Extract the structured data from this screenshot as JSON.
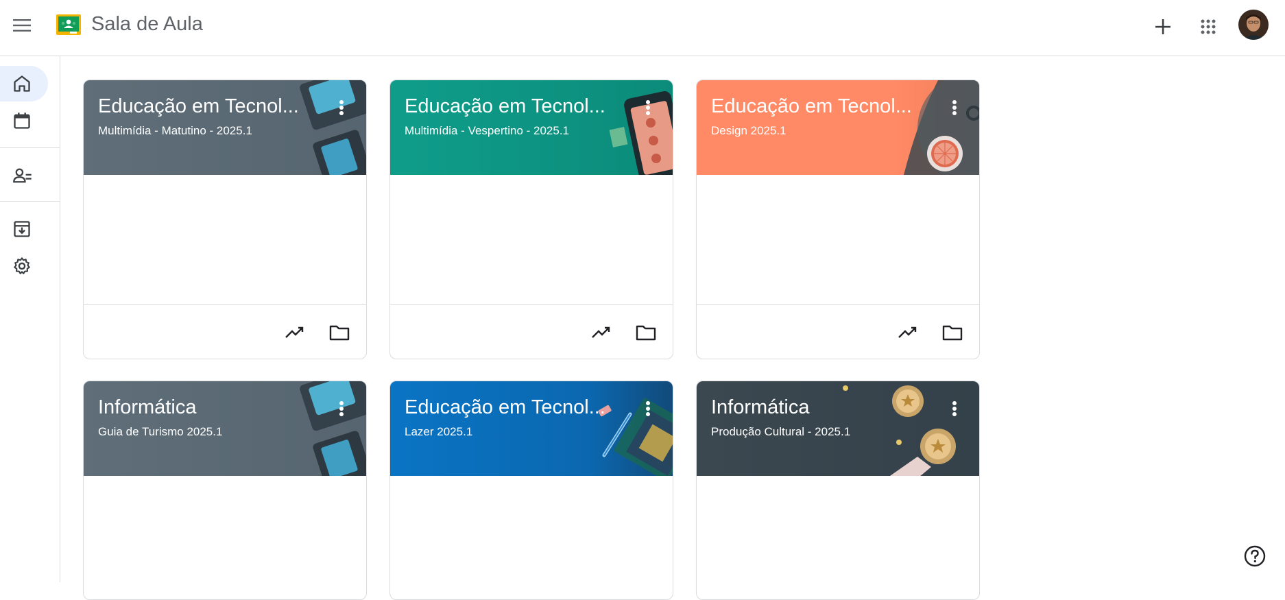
{
  "app": {
    "title": "Sala de Aula",
    "brand_color": "#0f9d58",
    "logo_accent": "#f4b400"
  },
  "header": {
    "menu_icon": "hamburger-menu-icon",
    "create_icon": "plus-icon",
    "apps_icon": "apps-grid-icon",
    "account_icon": "avatar"
  },
  "sidebar": {
    "items": [
      {
        "icon": "home-icon",
        "active": true
      },
      {
        "icon": "calendar-icon",
        "active": false
      },
      {
        "icon": "people-icon",
        "active": false
      },
      {
        "icon": "archive-icon",
        "active": false
      },
      {
        "icon": "gear-icon",
        "active": false
      }
    ]
  },
  "classes": [
    {
      "title": "Educação em Tecnol...",
      "subtitle": "Multimídia - Matutino - 2025.1",
      "color": "#5f6e78"
    },
    {
      "title": "Educação em Tecnol...",
      "subtitle": "Multimídia - Vespertino - 2025.1",
      "color": "#0f9d8a"
    },
    {
      "title": "Educação em Tecnol...",
      "subtitle": "Design 2025.1",
      "color": "#ff8a65"
    },
    {
      "title": "Informática",
      "subtitle": "Guia de Turismo 2025.1",
      "color": "#5f6e78"
    },
    {
      "title": "Educação em Tecnol...",
      "subtitle": "Lazer 2025.1",
      "color": "#0a74c4"
    },
    {
      "title": "Informática",
      "subtitle": "Produção Cultural - 2025.1",
      "color": "#3c4850"
    }
  ],
  "card_actions": {
    "progress_icon": "trending-up-icon",
    "folder_icon": "folder-icon"
  },
  "help_icon": "help-icon"
}
